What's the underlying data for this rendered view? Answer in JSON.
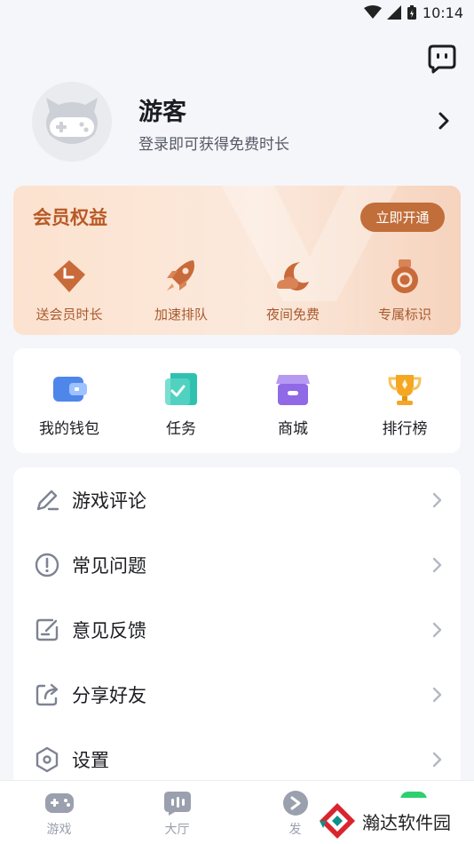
{
  "status_bar": {
    "time": "10:14"
  },
  "profile": {
    "name": "游客",
    "subtitle": "登录即可获得免费时长"
  },
  "member": {
    "title": "会员权益",
    "button": "立即开通",
    "items": [
      {
        "label": "送会员时长",
        "icon": "clock-tag-icon"
      },
      {
        "label": "加速排队",
        "icon": "rocket-icon"
      },
      {
        "label": "夜间免费",
        "icon": "moon-cloud-icon"
      },
      {
        "label": "专属标识",
        "icon": "medal-icon"
      }
    ]
  },
  "quick": {
    "items": [
      {
        "label": "我的钱包",
        "icon": "wallet-icon"
      },
      {
        "label": "任务",
        "icon": "task-icon"
      },
      {
        "label": "商城",
        "icon": "store-icon"
      },
      {
        "label": "排行榜",
        "icon": "trophy-icon"
      }
    ]
  },
  "menu": {
    "items": [
      {
        "label": "游戏评论",
        "icon": "pencil-icon"
      },
      {
        "label": "常见问题",
        "icon": "exclamation-circle-icon"
      },
      {
        "label": "意见反馈",
        "icon": "feedback-icon"
      },
      {
        "label": "分享好友",
        "icon": "share-icon"
      },
      {
        "label": "设置",
        "icon": "settings-hexagon-icon"
      }
    ]
  },
  "tabbar": {
    "tabs": [
      {
        "label": "游戏",
        "icon": "gamepad-icon"
      },
      {
        "label": "大厅",
        "icon": "chat-bubble-icon"
      },
      {
        "label": "发",
        "icon": "discover-icon"
      },
      {
        "label": "",
        "icon": "green-tab-icon"
      }
    ]
  },
  "watermark": {
    "text": "瀚达软件园"
  },
  "colors": {
    "accent_orange": "#c16e3a",
    "member_text": "#b85a26",
    "background": "#f5f6fa"
  }
}
